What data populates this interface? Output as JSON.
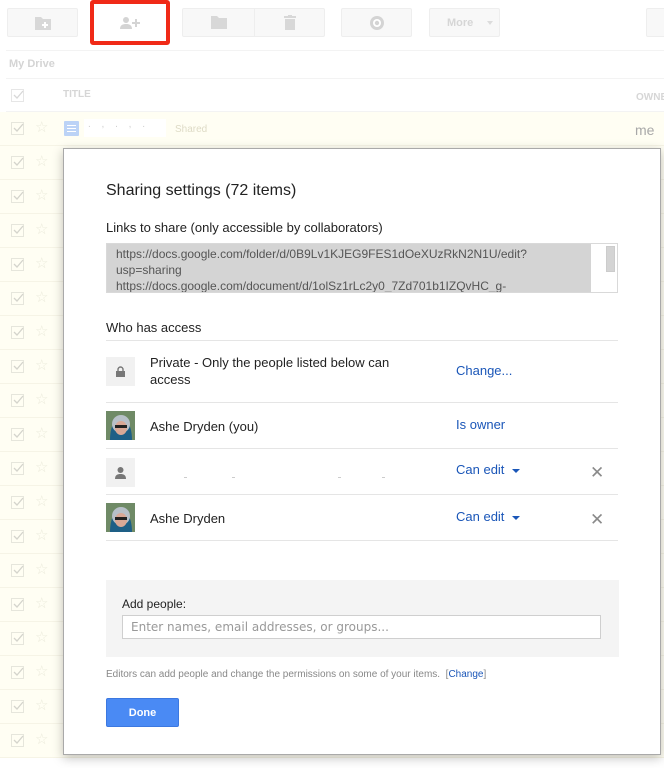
{
  "toolbar": {
    "buttons": [
      {
        "name": "new-folder",
        "icon": "folder-plus-icon"
      },
      {
        "name": "share",
        "icon": "person-add-icon",
        "highlighted": true
      },
      {
        "name": "move-to-folder",
        "icon": "folder-icon"
      },
      {
        "name": "remove",
        "icon": "trash-icon"
      },
      {
        "name": "preview",
        "icon": "eye-icon"
      },
      {
        "name": "more",
        "label": "More",
        "icon": "caret-down-icon"
      }
    ],
    "more_label": "More"
  },
  "breadcrumb": {
    "root": "My Drive"
  },
  "file_list": {
    "columns": {
      "title": "TITLE",
      "owner": "OWNE"
    },
    "first_row": {
      "name": ". , . , .",
      "tag": "Shared",
      "owner": "me"
    },
    "row_count": 19
  },
  "dialog": {
    "title": "Sharing settings (72 items)",
    "links_label": "Links to share (only accessible by collaborators)",
    "links_text": "https://docs.google.com/folder/d/0B9Lv1KJEG9FES1dOeXUzRkN2N1U/edit?\nusp=sharing\nhttps://docs.google.com/document/d/1olSz1rLc2y0_7Zd701b1IZQvHC_g-",
    "who_has_access_label": "Who has access",
    "access": [
      {
        "type": "visibility",
        "icon": "lock-icon",
        "name": "Private - Only the people listed below can access",
        "role": "Change...",
        "removable": false
      },
      {
        "type": "person",
        "icon": "avatar",
        "name": "Ashe Dryden (you)",
        "role": "Is owner",
        "removable": false
      },
      {
        "type": "person",
        "icon": "person-icon",
        "name": "",
        "role": "Can edit",
        "removable": true
      },
      {
        "type": "person",
        "icon": "avatar",
        "name": "Ashe Dryden",
        "role": "Can edit",
        "removable": true
      }
    ],
    "add_people_label": "Add people:",
    "add_people_placeholder": "Enter names, email addresses, or groups...",
    "add_people_value": "",
    "hint_text": "Editors can add people and change the permissions on some of your items.",
    "hint_link": "Change",
    "done_label": "Done"
  },
  "colors": {
    "highlight": "#f02a17",
    "link": "#1a56b8",
    "primary_button": "#4a8af4"
  }
}
